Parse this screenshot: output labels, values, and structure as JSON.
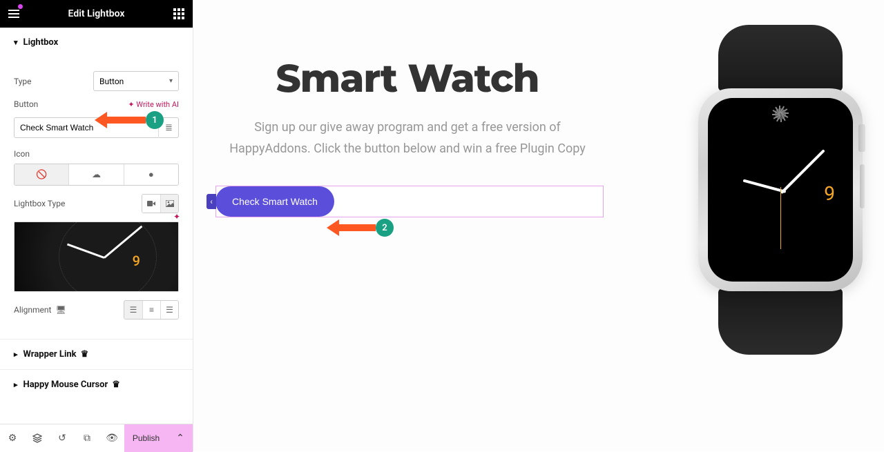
{
  "header": {
    "title": "Edit Lightbox"
  },
  "section_lightbox": {
    "title": "Lightbox",
    "type_label": "Type",
    "type_value": "Button",
    "button_label": "Button",
    "ai_label": "Write with AI",
    "button_value": "Check Smart Watch",
    "icon_label": "Icon",
    "lightbox_type_label": "Lightbox Type",
    "alignment_label": "Alignment",
    "preview_number": "9"
  },
  "section_wrapper": {
    "title": "Wrapper Link"
  },
  "section_cursor": {
    "title": "Happy Mouse Cursor"
  },
  "footer": {
    "publish_label": "Publish"
  },
  "hero": {
    "title": "Smart Watch",
    "subtitle": "Sign up our give away program and get a free version of HappyAddons. Click the button below and win a free Plugin Copy",
    "cta_label": "Check Smart Watch",
    "watch_number": "9"
  },
  "annotations": {
    "badge1": "1",
    "badge2": "2"
  }
}
